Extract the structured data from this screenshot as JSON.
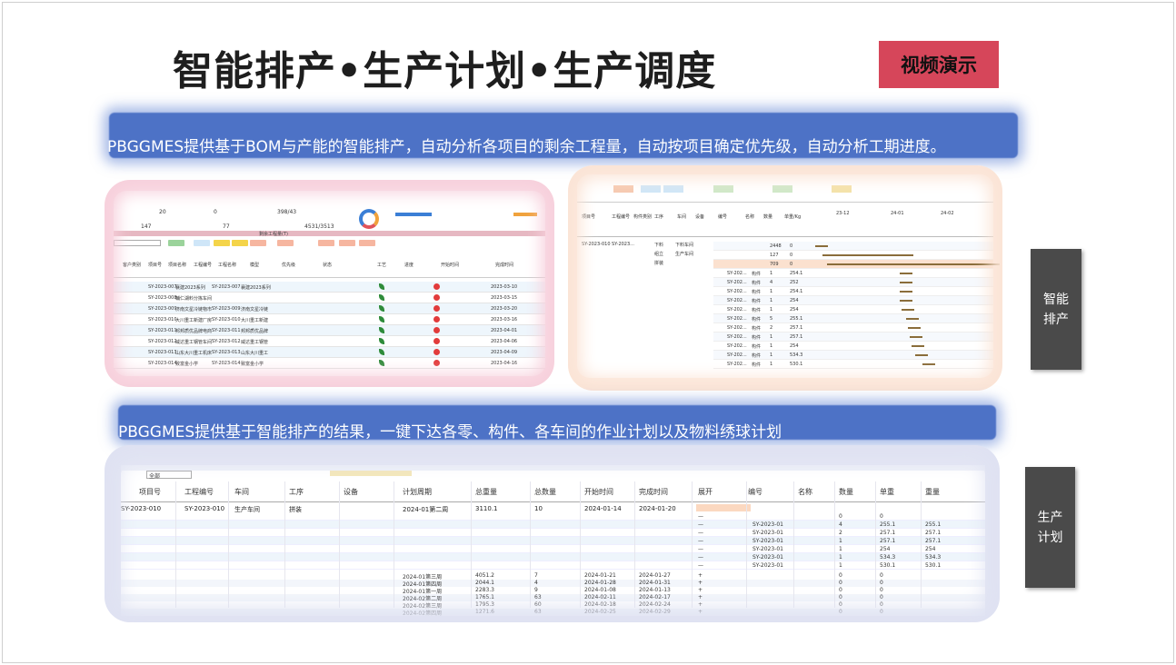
{
  "title": "智能排产•生产计划•生产调度",
  "video_button": "视频演示",
  "banner1": "PBGGMES提供基于BOM与产能的智能排产，自动分析各项目的剩余工程量，自动按项目确定优先级，自动分析工期进度。",
  "banner2": "PBGGMES提供基于智能排产的结果，一键下达各零、构件、各车间的作业计划以及物料绣球计划",
  "tags": {
    "scheduling": "智能\n排产",
    "planning": "生产\n计划"
  },
  "colors": {
    "banner": "#4d72c6",
    "video_button": "#d6465a",
    "tag": "#4a4a4a"
  },
  "panel1": {
    "stats": [
      "20",
      "0",
      "398/43",
      "77",
      "4531/3513",
      "147"
    ],
    "toolbar_value": "剩余工程量(T)",
    "filter_placeholder": "",
    "btn_search": "查询",
    "btn_reset": "重置",
    "headers": [
      "客户类别",
      "项目号",
      "项目名称",
      "工程编号",
      "工程名称",
      "模型",
      "优先级",
      "状态",
      "工艺",
      "进度",
      "开始时间",
      "完成时间"
    ],
    "rows": [
      {
        "proj": "SY-2023-007",
        "name": "襄建2023系列",
        "code": "SY-2023-007",
        "pname": "襄建2023系列",
        "date": "2023-03-10"
      },
      {
        "proj": "SY-2023-008",
        "name": "輔仁湖料分拣车间",
        "code": "",
        "pname": "",
        "date": "2023-03-15"
      },
      {
        "proj": "SY-2023-009",
        "name": "济南文星冷链物市",
        "code": "SY-2023-009",
        "pname": "济南文星冷链",
        "date": "2023-03-20"
      },
      {
        "proj": "SY-2023-010",
        "name": "大川重工新建厂房",
        "code": "SY-2023-010",
        "pname": "大川重工新建",
        "date": "2023-03-16"
      },
      {
        "proj": "SY-2023-011",
        "name": "邦邦质优品牌电商",
        "code": "SY-2023-011",
        "pname": "邦邦质优品牌",
        "date": "2023-04-01"
      },
      {
        "proj": "SY-2023-012",
        "name": "威达重工钢管车间",
        "code": "SY-2023-012",
        "pname": "威达重工钢管",
        "date": "2023-04-06"
      },
      {
        "proj": "SY-2023-013",
        "name": "山东大川重工机床",
        "code": "SY-2023-013",
        "pname": "山东大川重工",
        "date": "2023-04-09"
      },
      {
        "proj": "SY-2023-014",
        "name": "致富金小学",
        "code": "SY-2023-014",
        "pname": "致富金小学",
        "date": "2023-04-16"
      }
    ]
  },
  "panel2": {
    "headers": [
      "项目号",
      "工程编号",
      "构件类别",
      "工序",
      "车间",
      "设备",
      "编号",
      "名称",
      "数量",
      "单重/Kg"
    ],
    "months": [
      "23-12",
      "24-01",
      "24-02"
    ],
    "first_row": {
      "proj": "SY-2023-010",
      "code": "SY-2023...",
      "op1": "下料",
      "ws1": "下料车间",
      "op2": "组立",
      "ws2": "生产车间",
      "op3": "拼装"
    },
    "rows": [
      {
        "no": "",
        "name": "",
        "qty": "2448",
        "w": "0"
      },
      {
        "no": "",
        "name": "",
        "qty": "127",
        "w": "0"
      },
      {
        "no": "",
        "name": "",
        "qty": "709",
        "w": "0"
      },
      {
        "no": "SY-202...",
        "name": "构件",
        "qty": "1",
        "w": "254.1"
      },
      {
        "no": "SY-202...",
        "name": "构件",
        "qty": "4",
        "w": "252"
      },
      {
        "no": "SY-202...",
        "name": "构件",
        "qty": "1",
        "w": "254.1"
      },
      {
        "no": "SY-202...",
        "name": "构件",
        "qty": "1",
        "w": "254"
      },
      {
        "no": "SY-202...",
        "name": "构件",
        "qty": "1",
        "w": "254"
      },
      {
        "no": "SY-202...",
        "name": "构件",
        "qty": "5",
        "w": "255.1"
      },
      {
        "no": "SY-202...",
        "name": "构件",
        "qty": "2",
        "w": "257.1"
      },
      {
        "no": "SY-202...",
        "name": "构件",
        "qty": "1",
        "w": "257.1"
      },
      {
        "no": "SY-202...",
        "name": "构件",
        "qty": "1",
        "w": "254"
      },
      {
        "no": "SY-202...",
        "name": "构件",
        "qty": "1",
        "w": "534.3"
      },
      {
        "no": "SY-202...",
        "name": "构件",
        "qty": "1",
        "w": "530.1"
      }
    ]
  },
  "panel3": {
    "filter_value": "全部",
    "headers": [
      "项目号",
      "工程编号",
      "车间",
      "工序",
      "设备",
      "计划周期",
      "总重量",
      "总数量",
      "开始时间",
      "完成时间",
      "展开",
      "编号",
      "名称",
      "数量",
      "单重",
      "重量"
    ],
    "main_row": {
      "proj": "SY-2023-010",
      "code": "SY-2023-010",
      "ws": "生产车间",
      "op": "拼装",
      "period": "2024-01第二周",
      "weight": "3110.1",
      "qty": "10",
      "start": "2024-01-14",
      "end": "2024-01-20"
    },
    "detail_rows": [
      {
        "no": "",
        "qty": "0",
        "w": "0",
        "tw": ""
      },
      {
        "no": "SY-2023-01",
        "qty": "4",
        "w": "255.1",
        "tw": "255.1"
      },
      {
        "no": "SY-2023-01",
        "qty": "2",
        "w": "257.1",
        "tw": "257.1"
      },
      {
        "no": "SY-2023-01",
        "qty": "1",
        "w": "257.1",
        "tw": "257.1"
      },
      {
        "no": "SY-2023-01",
        "qty": "1",
        "w": "254",
        "tw": "254"
      },
      {
        "no": "SY-2023-01",
        "qty": "1",
        "w": "534.3",
        "tw": "534.3"
      },
      {
        "no": "SY-2023-01",
        "qty": "1",
        "w": "530.1",
        "tw": "530.1"
      }
    ],
    "period_rows": [
      {
        "period": "2024-01第三周",
        "weight": "4051.2",
        "qty": "7",
        "start": "2024-01-21",
        "end": "2024-01-27"
      },
      {
        "period": "2024-01第四周",
        "weight": "2044.1",
        "qty": "4",
        "start": "2024-01-28",
        "end": "2024-01-31"
      },
      {
        "period": "2024-01第一周",
        "weight": "2283.3",
        "qty": "9",
        "start": "2024-01-08",
        "end": "2024-01-13"
      },
      {
        "period": "2024-02第二周",
        "weight": "1765.1",
        "qty": "63",
        "start": "2024-02-11",
        "end": "2024-02-17"
      },
      {
        "period": "2024-02第三周",
        "weight": "1795.3",
        "qty": "60",
        "start": "2024-02-18",
        "end": "2024-02-24"
      },
      {
        "period": "2024-02第四周",
        "weight": "1271.6",
        "qty": "63",
        "start": "2024-02-25",
        "end": "2024-02-29"
      }
    ]
  }
}
